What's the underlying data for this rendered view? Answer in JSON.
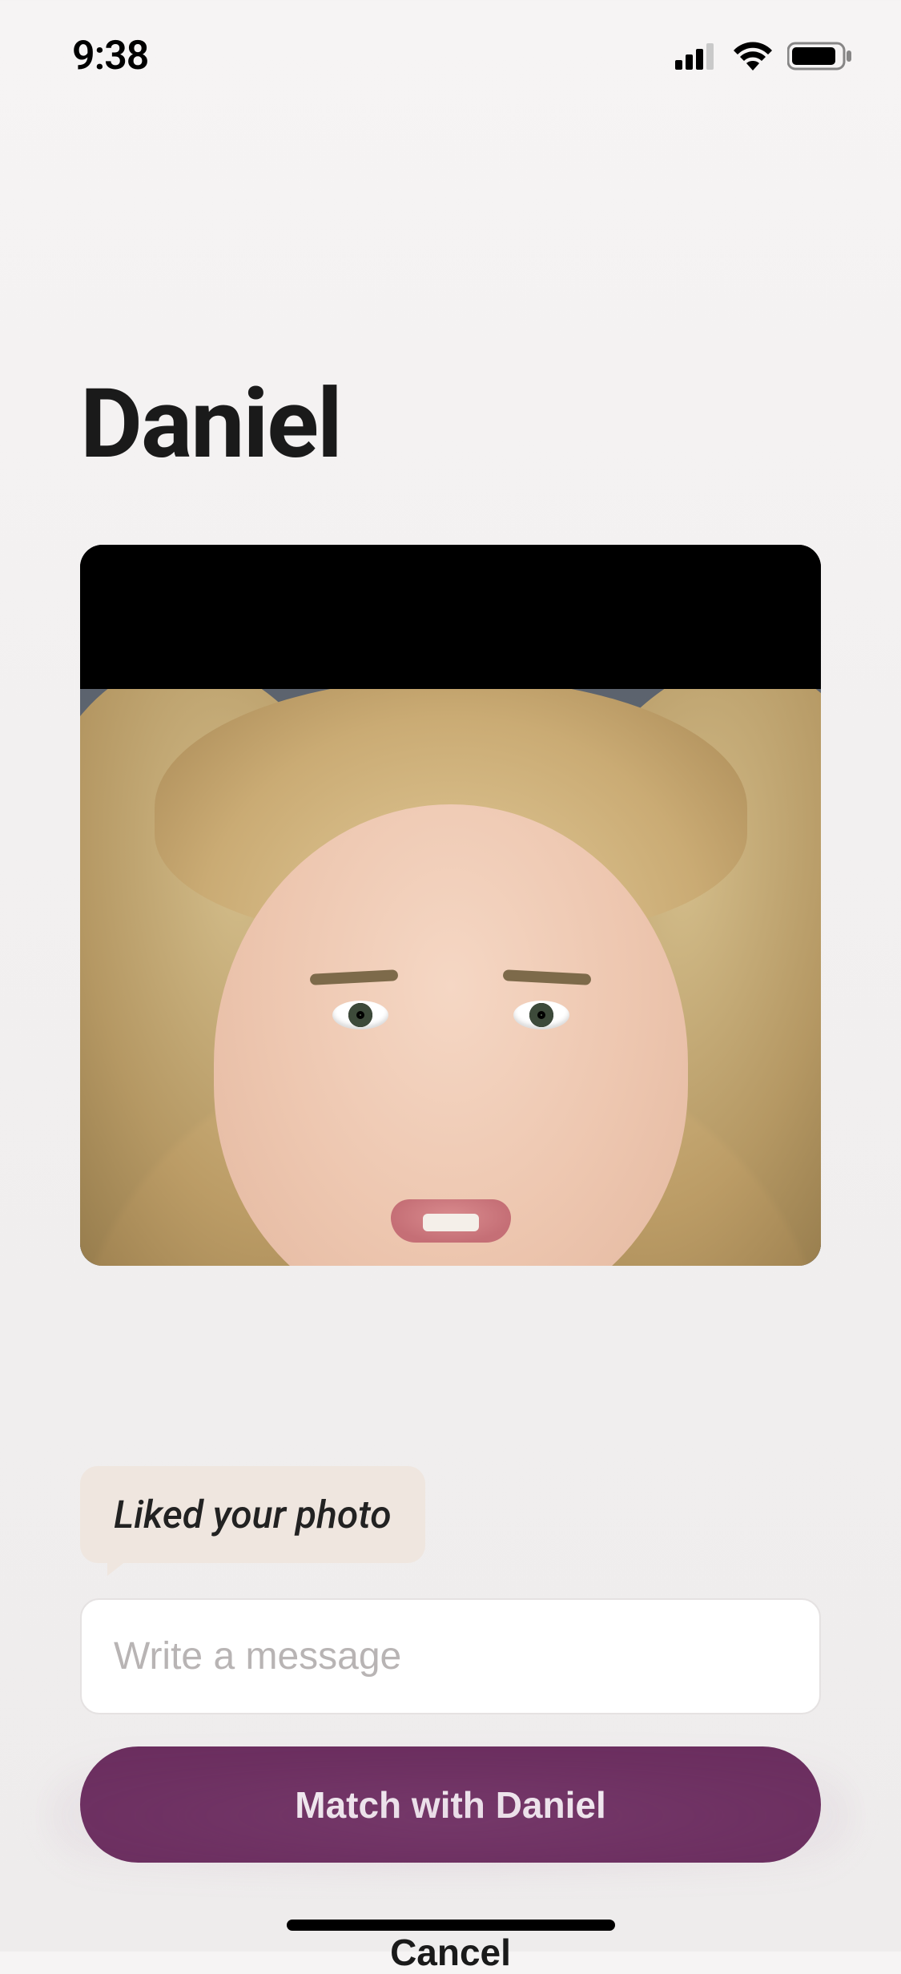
{
  "status": {
    "time": "9:38"
  },
  "profile": {
    "name": "Daniel",
    "like_note": "Liked your photo"
  },
  "message": {
    "placeholder": "Write a message"
  },
  "actions": {
    "match_label": "Match with Daniel",
    "cancel_label": "Cancel"
  },
  "colors": {
    "accent": "#6b2e5f",
    "bubble": "#efe6df"
  }
}
